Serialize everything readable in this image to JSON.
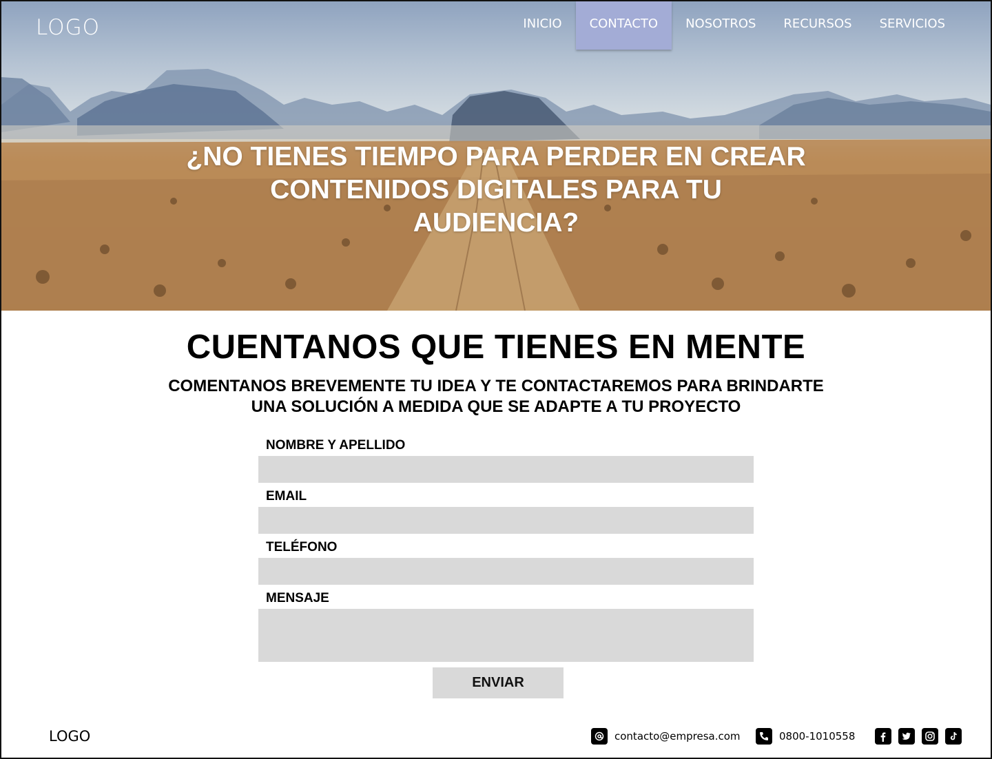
{
  "header": {
    "logo": "LOGO",
    "nav": [
      {
        "label": "INICIO",
        "active": false
      },
      {
        "label": "CONTACTO",
        "active": true
      },
      {
        "label": "NOSOTROS",
        "active": false
      },
      {
        "label": "RECURSOS",
        "active": false
      },
      {
        "label": "SERVICIOS",
        "active": false
      }
    ],
    "active_color": "#a3acd6"
  },
  "hero": {
    "title_lines": [
      "¿NO TIENES TIEMPO PARA PERDER EN CREAR",
      "CONTENIDOS DIGITALES PARA TU",
      "AUDIENCIA?"
    ]
  },
  "main": {
    "title": "CUENTANOS QUE TIENES EN MENTE",
    "subtitle_lines": [
      "COMENTANOS BREVEMENTE TU IDEA Y TE CONTACTAREMOS PARA BRINDARTE",
      "UNA SOLUCIÓN A MEDIDA QUE SE ADAPTE A TU PROYECTO"
    ]
  },
  "form": {
    "name_label": "NOMBRE Y APELLIDO",
    "name_value": "",
    "email_label": "EMAIL",
    "email_value": "",
    "phone_label": "TELÉFONO",
    "phone_value": "",
    "message_label": "MENSAJE",
    "message_value": "",
    "submit_label": "ENVIAR",
    "field_color": "#d9d9d9"
  },
  "footer": {
    "logo": "LOGO",
    "email": "contacto@empresa.com",
    "phone": "0800-1010558",
    "email_icon": "at-icon",
    "phone_icon": "phone-icon",
    "socials": [
      "facebook-icon",
      "twitter-icon",
      "instagram-icon",
      "tiktok-icon"
    ]
  }
}
